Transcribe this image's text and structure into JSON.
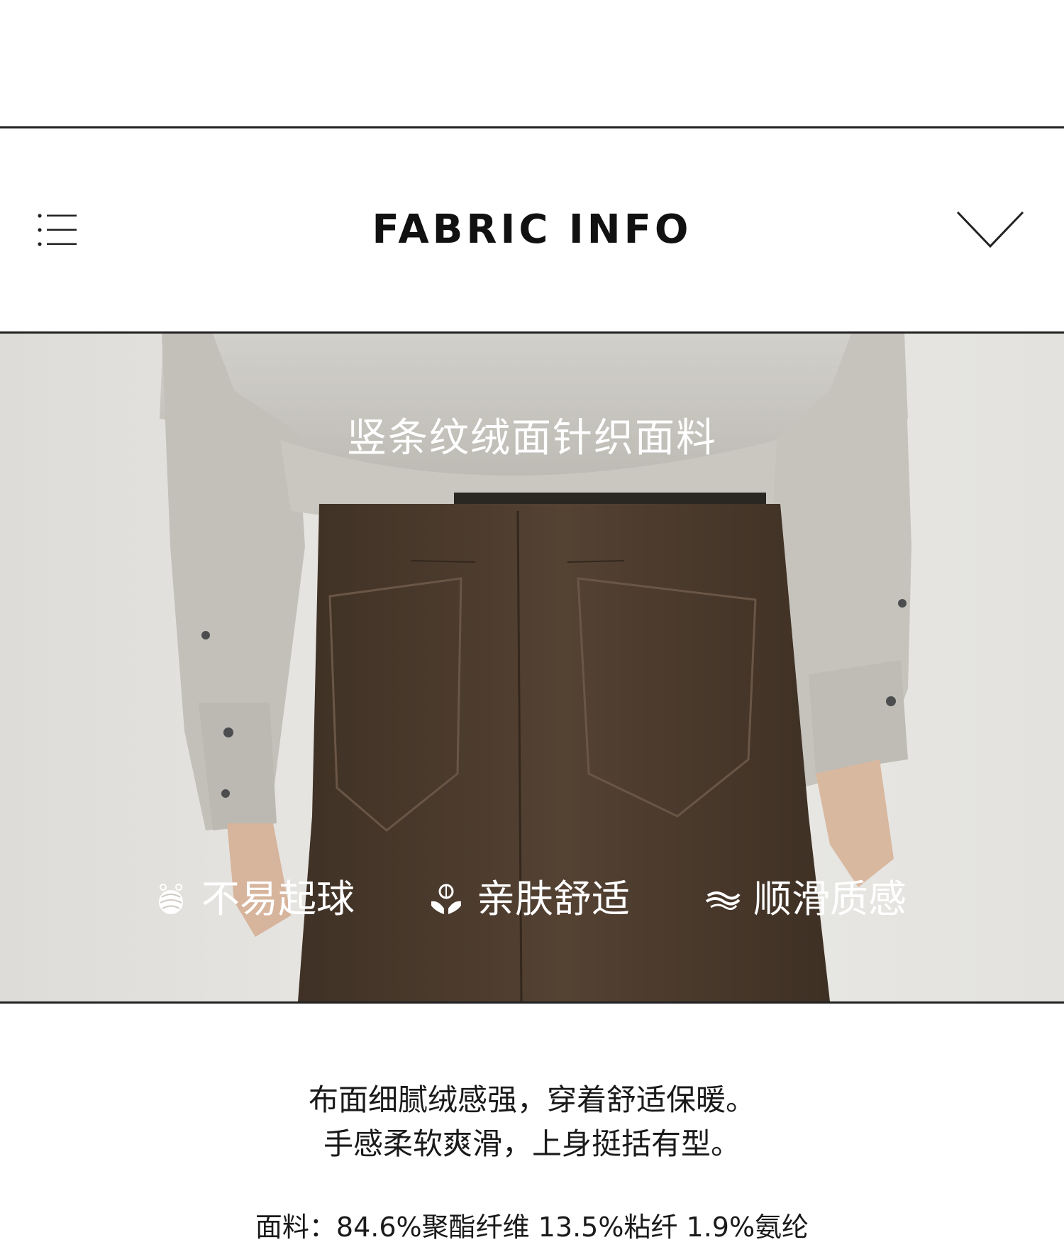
{
  "header": {
    "title": "FABRIC INFO",
    "menu_icon": "menu-list-icon",
    "toggle_icon": "chevron-down-icon"
  },
  "hero": {
    "heading": "竖条纹绒面针织面料",
    "features": [
      {
        "icon": "yarn-ball-icon",
        "label": "不易起球"
      },
      {
        "icon": "cotton-hand-icon",
        "label": "亲肤舒适"
      },
      {
        "icon": "smooth-wave-icon",
        "label": "顺滑质感"
      }
    ]
  },
  "description": {
    "line1": "布面细腻绒感强，穿着舒适保暖。",
    "line2": "手感柔软爽滑，上身挺括有型。",
    "composition": "面料：84.6%聚酯纤维 13.5%粘纤 1.9%氨纶"
  },
  "colors": {
    "rule": "#222222",
    "background": "#ffffff",
    "shirt": "#c4c2bb",
    "trousers": "#4a3a2c",
    "studio_backdrop": "#e6e5e2"
  }
}
